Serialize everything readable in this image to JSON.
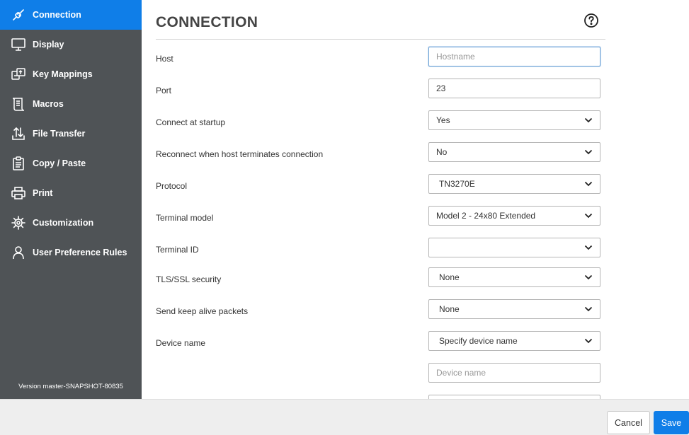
{
  "sidebar": {
    "items": [
      {
        "label": "Connection",
        "icon": "connection-plug-icon",
        "active": true
      },
      {
        "label": "Display",
        "icon": "monitor-icon"
      },
      {
        "label": "Key Mappings",
        "icon": "key-mappings-icon"
      },
      {
        "label": "Macros",
        "icon": "macros-scroll-icon"
      },
      {
        "label": "File Transfer",
        "icon": "file-transfer-icon"
      },
      {
        "label": "Copy / Paste",
        "icon": "clipboard-icon"
      },
      {
        "label": "Print",
        "icon": "printer-icon"
      },
      {
        "label": "Customization",
        "icon": "gear-icon"
      },
      {
        "label": "User Preference Rules",
        "icon": "user-icon"
      }
    ],
    "version": "Version master-SNAPSHOT-80835"
  },
  "main": {
    "title": "CONNECTION",
    "help_icon": "help-circle-icon",
    "fields": {
      "host": {
        "label": "Host",
        "value": "",
        "placeholder": "Hostname"
      },
      "port": {
        "label": "Port",
        "value": "23"
      },
      "connect_at_startup": {
        "label": "Connect at startup",
        "value": "Yes"
      },
      "reconnect": {
        "label": "Reconnect when host terminates connection",
        "value": "No"
      },
      "protocol": {
        "label": "Protocol",
        "value": "TN3270E"
      },
      "terminal_model": {
        "label": "Terminal model",
        "value": "Model 2 - 24x80 Extended"
      },
      "terminal_id": {
        "label": "Terminal ID",
        "value": ""
      },
      "tls_ssl_security": {
        "label": "TLS/SSL security",
        "value": "None"
      },
      "keep_alive": {
        "label": "Send keep alive packets",
        "value": "None"
      },
      "device_name": {
        "label": "Device name",
        "value": "Specify device name"
      },
      "device_name_input": {
        "value": "",
        "placeholder": "Device name"
      }
    }
  },
  "footer": {
    "cancel_label": "Cancel",
    "save_label": "Save"
  },
  "colors": {
    "accent": "#0f7ee8",
    "sidebar_bg": "#4f5356"
  }
}
